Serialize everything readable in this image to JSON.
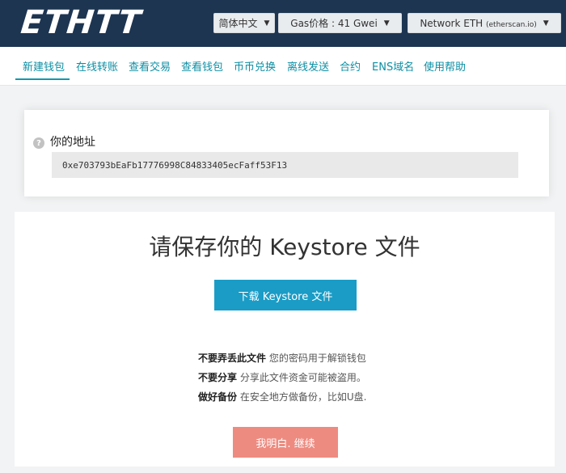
{
  "header": {
    "logo": "ETHTT",
    "language": "简体中文",
    "gas_price": "Gas价格 : 41 Gwei",
    "network_main": "Network ETH",
    "network_sub": "(etherscan.io)"
  },
  "nav": {
    "items": [
      {
        "label": "新建钱包",
        "active": true
      },
      {
        "label": "在线转账"
      },
      {
        "label": "查看交易"
      },
      {
        "label": "查看钱包"
      },
      {
        "label": "币币兑换"
      },
      {
        "label": "离线发送"
      },
      {
        "label": "合约"
      },
      {
        "label": "ENS域名"
      },
      {
        "label": "使用帮助"
      }
    ]
  },
  "address_card": {
    "label": "你的地址",
    "address": "0xe703793bEaFb17776998C84833405ecFaff53F13"
  },
  "main": {
    "title": "请保存你的 Keystore 文件",
    "download_button": "下载 Keystore 文件",
    "warnings": [
      {
        "bold": "不要弄丢此文件",
        "text": " 您的密码用于解锁钱包"
      },
      {
        "bold": "不要分享",
        "text": " 分享此文件资金可能被盗用。"
      },
      {
        "bold": "做好备份",
        "text": " 在安全地方做备份，比如U盘."
      }
    ],
    "confirm_button": "我明白. 继续"
  },
  "colors": {
    "header_bg": "#1d3551",
    "nav_link": "#0c8fa4",
    "download_button": "#1a9cc6",
    "confirm_button": "#ee8b80"
  }
}
